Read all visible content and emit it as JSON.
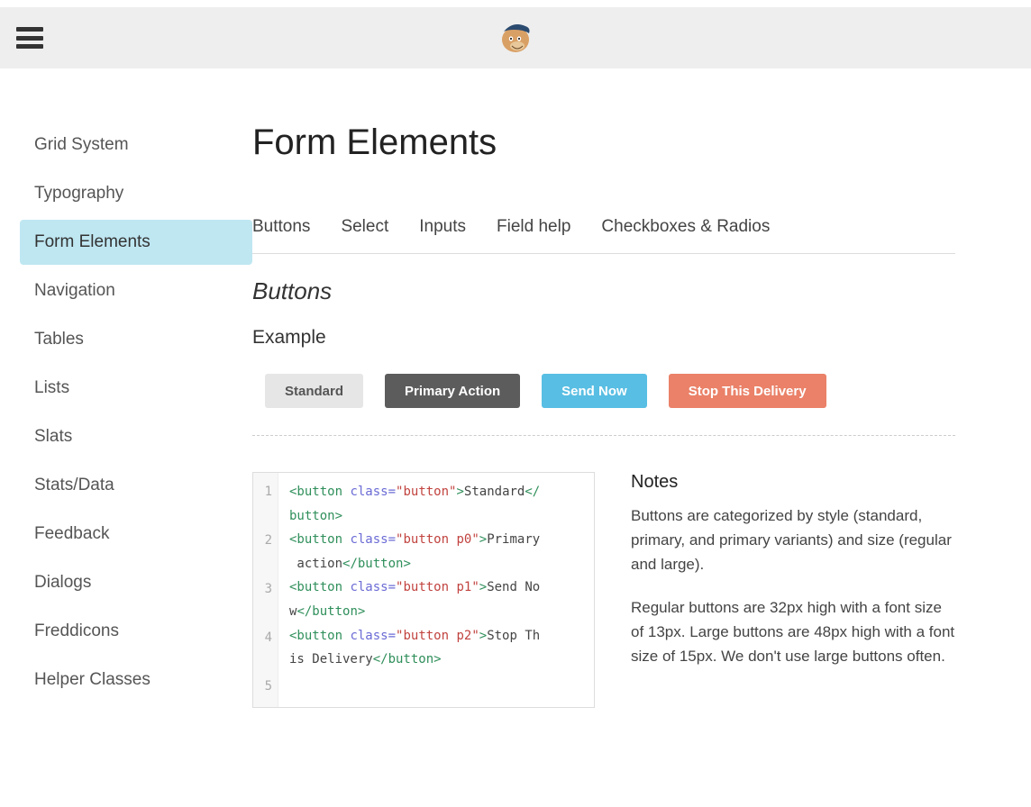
{
  "sidebar": {
    "items": [
      {
        "label": "Grid System"
      },
      {
        "label": "Typography"
      },
      {
        "label": "Form Elements",
        "active": true
      },
      {
        "label": "Navigation"
      },
      {
        "label": "Tables"
      },
      {
        "label": "Lists"
      },
      {
        "label": "Slats"
      },
      {
        "label": "Stats/Data"
      },
      {
        "label": "Feedback"
      },
      {
        "label": "Dialogs"
      },
      {
        "label": "Freddicons"
      },
      {
        "label": "Helper Classes"
      }
    ]
  },
  "page": {
    "title": "Form Elements"
  },
  "tabs": [
    {
      "label": "Buttons"
    },
    {
      "label": "Select"
    },
    {
      "label": "Inputs"
    },
    {
      "label": "Field help"
    },
    {
      "label": "Checkboxes & Radios"
    }
  ],
  "section": {
    "title": "Buttons",
    "example_heading": "Example"
  },
  "example_buttons": {
    "standard": "Standard",
    "primary": "Primary Action",
    "send": "Send Now",
    "stop": "Stop This Delivery"
  },
  "code": {
    "lines": [
      {
        "num": "1",
        "cls": "button",
        "text": "Standard"
      },
      {
        "num": "2",
        "cls": "button p0",
        "text": "Primary action"
      },
      {
        "num": "3",
        "cls": "button p1",
        "text": "Send Now"
      },
      {
        "num": "4",
        "cls": "button p2",
        "text": "Stop This Delivery"
      },
      {
        "num": "5"
      }
    ]
  },
  "notes": {
    "heading": "Notes",
    "p1": "Buttons are categorized by style (standard, primary, and primary variants) and size (regular and large).",
    "p2": "Regular buttons are 32px high with a font size of 13px. Large buttons are 48px high with a font size of 15px. We don't use large buttons often."
  }
}
